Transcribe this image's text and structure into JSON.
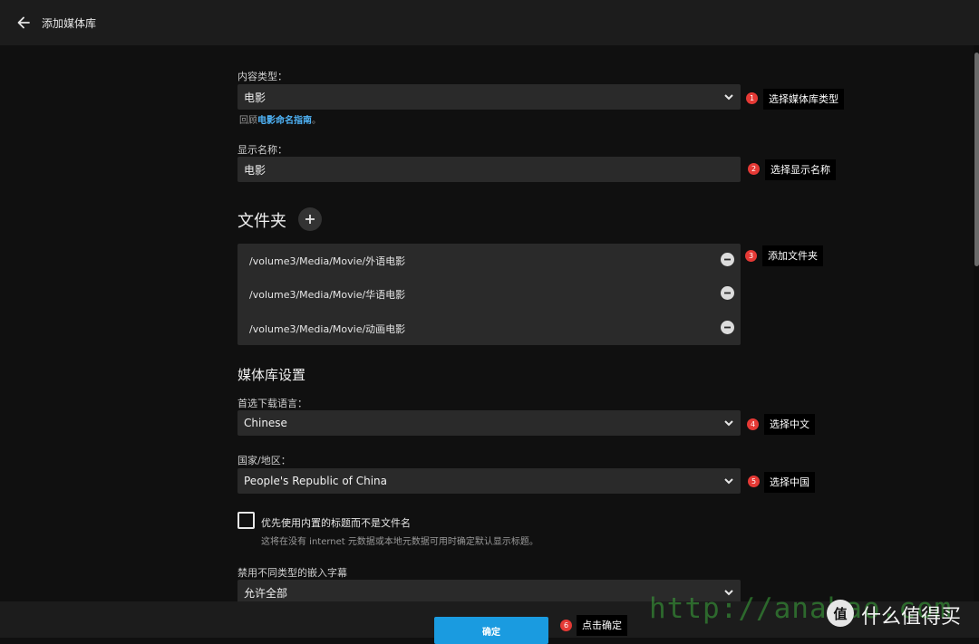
{
  "header": {
    "title": "添加媒体库"
  },
  "content_type": {
    "label": "内容类型：",
    "value": "电影",
    "hint_prefix": "回顾",
    "hint_link": "电影命名指南",
    "hint_suffix": "。"
  },
  "display_name": {
    "label": "显示名称：",
    "value": "电影"
  },
  "folders": {
    "title": "文件夹",
    "items": [
      {
        "path": "/volume3/Media/Movie/外语电影"
      },
      {
        "path": "/volume3/Media/Movie/华语电影"
      },
      {
        "path": "/volume3/Media/Movie/动画电影"
      }
    ]
  },
  "library_settings": {
    "title": "媒体库设置",
    "preferred_language": {
      "label": "首选下载语言：",
      "value": "Chinese"
    },
    "country": {
      "label": "国家/地区：",
      "value": "People's Republic of China"
    },
    "prefer_embedded_titles": {
      "label": "优先使用内置的标题而不是文件名",
      "description": "这将在没有 internet 元数据或本地元数据可用时确定默认显示标题。",
      "checked": false
    },
    "disable_subtitles": {
      "label": "禁用不同类型的嵌入字幕",
      "value": "允许全部"
    }
  },
  "confirm_label": "确定",
  "annotations": [
    {
      "num": "1",
      "text": "选择媒体库类型"
    },
    {
      "num": "2",
      "text": "选择显示名称"
    },
    {
      "num": "3",
      "text": "添加文件夹"
    },
    {
      "num": "4",
      "text": "选择中文"
    },
    {
      "num": "5",
      "text": "选择中国"
    },
    {
      "num": "6",
      "text": "点击确定"
    }
  ],
  "watermark": {
    "url": "http://anahao.com",
    "brand_logo": "值",
    "brand": "什么值得买"
  },
  "colors": {
    "accent": "#1a9be0",
    "link": "#4fb3f6",
    "badge": "#e53935",
    "background": "#101010",
    "field": "#2a2a2a"
  },
  "icons": {
    "back": "arrow-left-icon",
    "dropdown": "chevron-down-icon",
    "add": "plus-icon",
    "remove": "minus-circle-icon"
  }
}
